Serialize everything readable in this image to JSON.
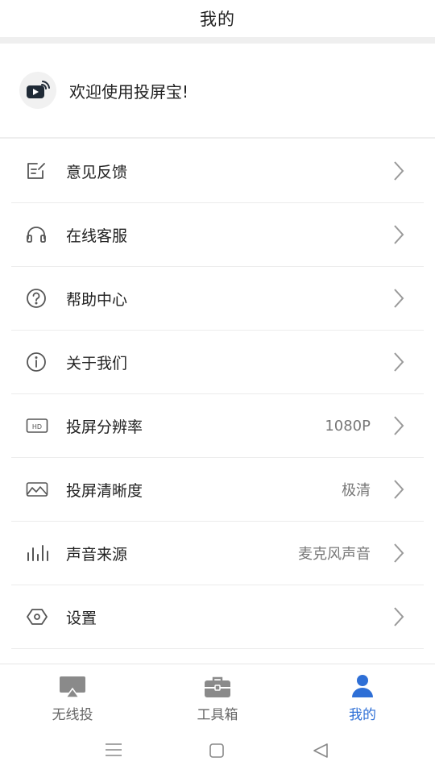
{
  "header": {
    "title": "我的"
  },
  "welcome": {
    "icon": "play-cast-icon",
    "text": "欢迎使用投屏宝!"
  },
  "menu": {
    "items": [
      {
        "icon": "edit-note-icon",
        "label": "意见反馈",
        "value": ""
      },
      {
        "icon": "headphones-icon",
        "label": "在线客服",
        "value": ""
      },
      {
        "icon": "help-circle-icon",
        "label": "帮助中心",
        "value": ""
      },
      {
        "icon": "info-circle-icon",
        "label": "关于我们",
        "value": ""
      },
      {
        "icon": "hd-icon",
        "label": "投屏分辨率",
        "value": "1080P"
      },
      {
        "icon": "image-icon",
        "label": "投屏清晰度",
        "value": "极清"
      },
      {
        "icon": "sound-bars-icon",
        "label": "声音来源",
        "value": "麦克风声音"
      },
      {
        "icon": "settings-hexagon-icon",
        "label": "设置",
        "value": ""
      }
    ]
  },
  "tabs": [
    {
      "icon": "screen-cast-icon",
      "label": "无线投",
      "active": false
    },
    {
      "icon": "toolbox-icon",
      "label": "工具箱",
      "active": false
    },
    {
      "icon": "user-icon",
      "label": "我的",
      "active": true
    }
  ],
  "colors": {
    "accent": "#2e6fd6",
    "icon_gray": "#555555",
    "chevron": "#999999"
  }
}
